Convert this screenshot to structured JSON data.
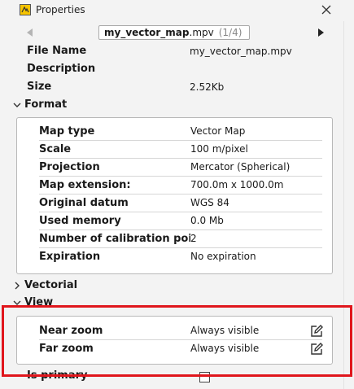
{
  "window": {
    "title": "Properties"
  },
  "file_tab": {
    "name": "my_vector_map",
    "ext": ".mpv",
    "index": "(1/4)"
  },
  "info": [
    {
      "label": "File Name",
      "value": "my_vector_map.mpv"
    },
    {
      "label": "Description",
      "value": ""
    },
    {
      "label": "Size",
      "value": "2.52Kb"
    }
  ],
  "sections": {
    "format": "Format",
    "vectorial": "Vectorial",
    "view": "View"
  },
  "format_rows": [
    {
      "label": "Map type",
      "value": "Vector Map"
    },
    {
      "label": "Scale",
      "value": "100 m/pixel"
    },
    {
      "label": "Projection",
      "value": "Mercator (Spherical)"
    },
    {
      "label": "Map extension:",
      "value": "700.0m x 1000.0m"
    },
    {
      "label": "Original datum",
      "value": "WGS 84"
    },
    {
      "label": "Used memory",
      "value": "0.0 Mb"
    },
    {
      "label": "Number of calibration points",
      "value": "2"
    },
    {
      "label": "Expiration",
      "value": "No expiration"
    }
  ],
  "view_rows": [
    {
      "label": "Near zoom",
      "value": "Always visible"
    },
    {
      "label": "Far zoom",
      "value": "Always visible"
    }
  ],
  "primary": {
    "label": "Is primary",
    "checked": false
  },
  "colors": {
    "highlight": "#e0161c",
    "app_icon": "#f6c400"
  },
  "icons": [
    "app-icon",
    "close-icon",
    "arrow-left-icon",
    "arrow-right-icon",
    "chevron-down-icon",
    "chevron-right-icon",
    "edit-icon"
  ]
}
